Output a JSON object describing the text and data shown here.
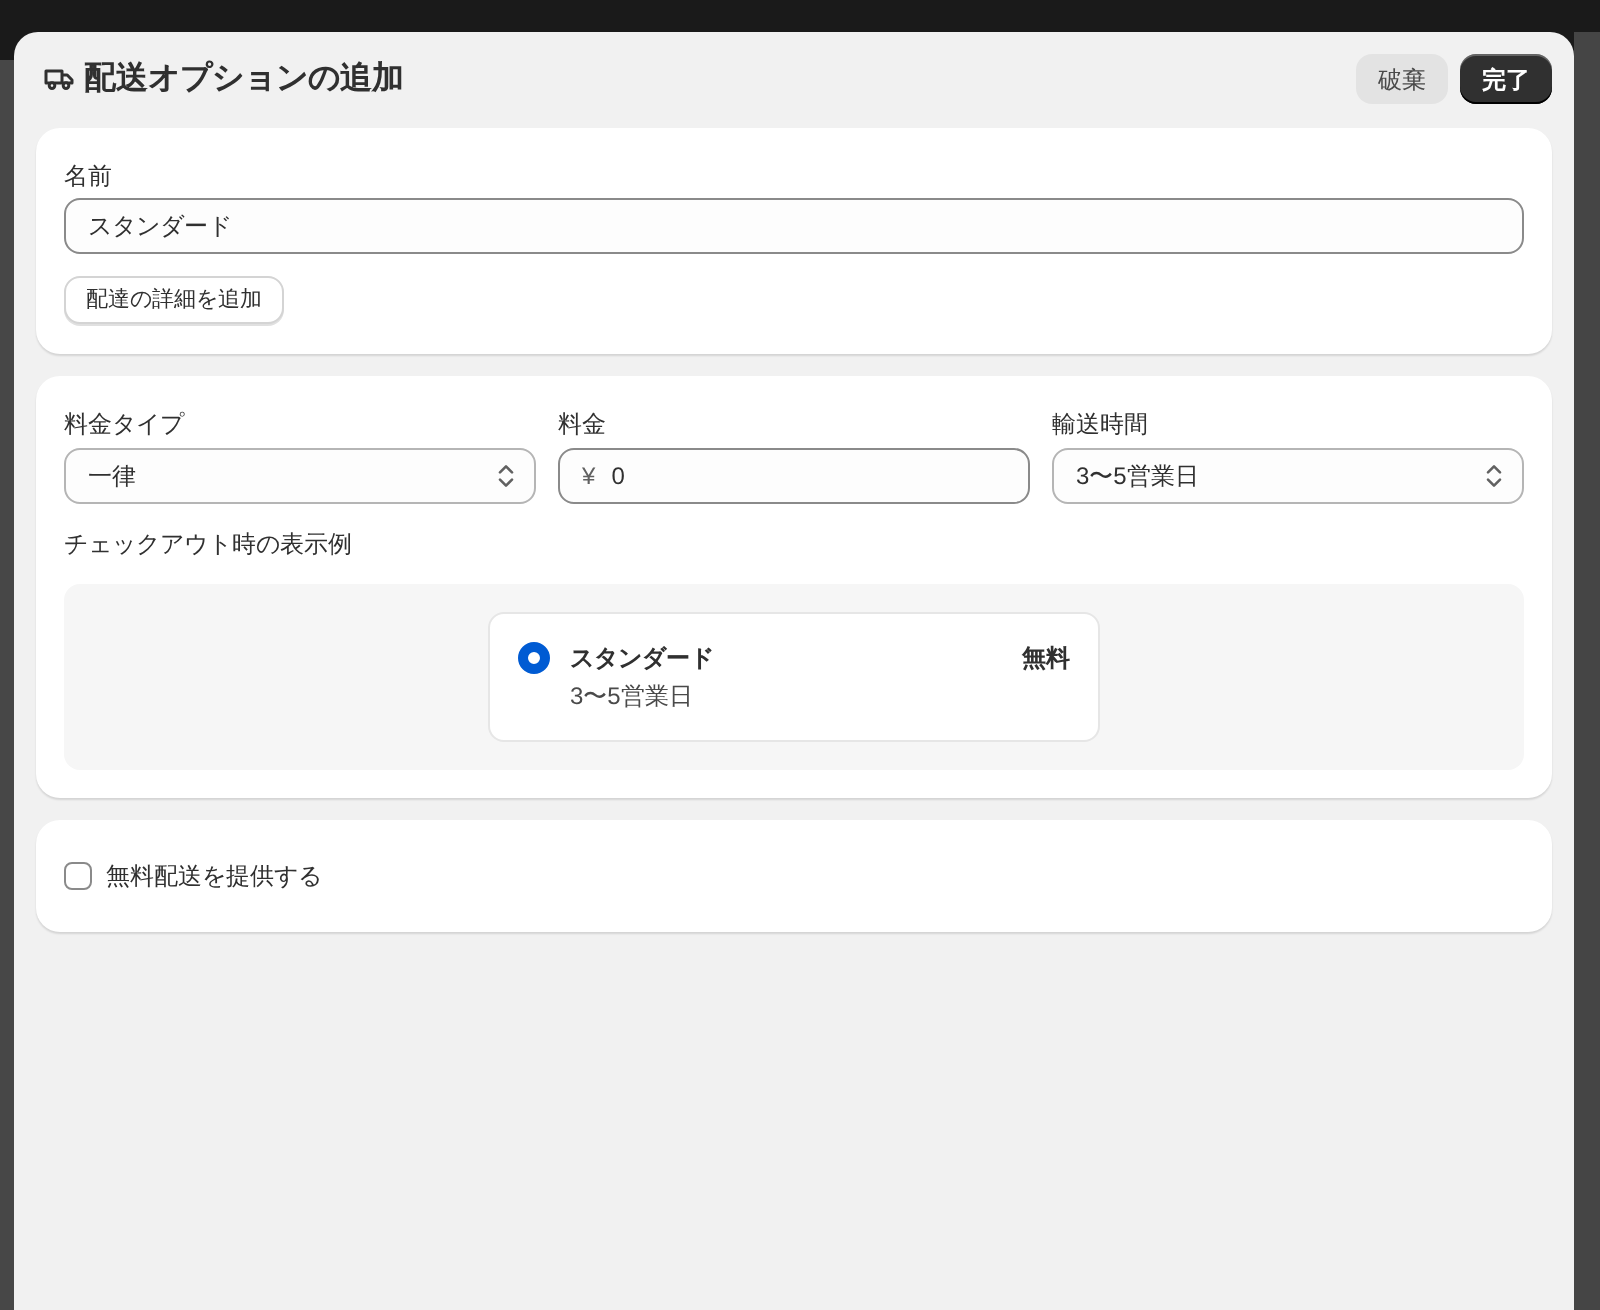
{
  "modal": {
    "title": "配送オプションの追加",
    "buttons": [
      {
        "label": "破棄",
        "kind": "secondary"
      },
      {
        "label": "完了",
        "kind": "primary"
      }
    ]
  },
  "name_section": {
    "label": "名前",
    "value": "スタンダード",
    "add_details_button": "配達の詳細を追加"
  },
  "rate_section": {
    "fields": [
      {
        "kind": "select",
        "label": "料金タイプ",
        "value": "一律"
      },
      {
        "kind": "currency",
        "label": "料金",
        "prefix": "¥",
        "value": "0"
      },
      {
        "kind": "select",
        "label": "輸送時間",
        "value": "3〜5営業日"
      }
    ],
    "preview": {
      "label": "チェックアウト時の表示例",
      "option": {
        "name": "スタンダード",
        "detail": "3〜5営業日",
        "price": "無料",
        "selected": true
      }
    }
  },
  "free_shipping": {
    "label": "無料配送を提供する",
    "checked": false
  }
}
